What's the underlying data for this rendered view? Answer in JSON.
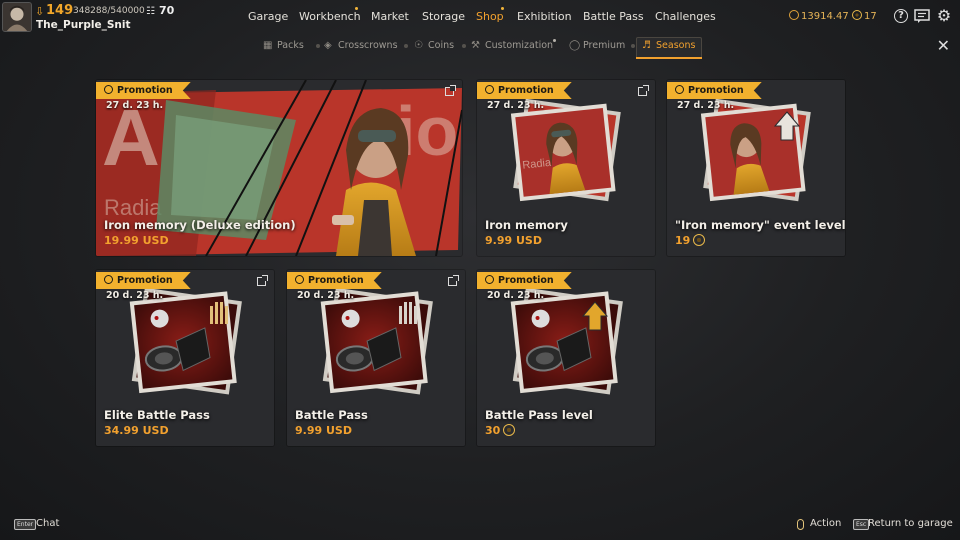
{
  "player": {
    "level": "149",
    "xp": "348288/540000",
    "prestige": "70",
    "username": "The_Purple_Snit"
  },
  "nav": {
    "items": [
      {
        "label": "Garage",
        "active": false,
        "dot": false
      },
      {
        "label": "Workbench",
        "active": false,
        "dot": true
      },
      {
        "label": "Market",
        "active": false,
        "dot": false
      },
      {
        "label": "Storage",
        "active": false,
        "dot": false
      },
      {
        "label": "Shop",
        "active": true,
        "dot": true
      },
      {
        "label": "Exhibition",
        "active": false,
        "dot": false
      },
      {
        "label": "Battle Pass",
        "active": false,
        "dot": false
      },
      {
        "label": "Challenges",
        "active": false,
        "dot": false
      }
    ]
  },
  "currencies": {
    "coins": "13914.47",
    "badges": "17"
  },
  "top_icons": [
    "help-icon",
    "news-icon",
    "settings-icon"
  ],
  "subtabs": [
    {
      "label": "Packs",
      "icon": "packs-icon"
    },
    {
      "label": "Crosscrowns",
      "icon": "crosscrowns-icon"
    },
    {
      "label": "Coins",
      "icon": "coins-icon"
    },
    {
      "label": "Customization",
      "icon": "customization-icon",
      "dot": true
    },
    {
      "label": "Premium",
      "icon": "premium-icon"
    },
    {
      "label": "Seasons",
      "icon": "seasons-icon",
      "active": true
    }
  ],
  "cards": [
    {
      "promo": "Promotion",
      "timer": "27 d. 23 h.",
      "title": "Iron memory (Deluxe edition)",
      "price": "19.99 USD",
      "external": true
    },
    {
      "promo": "Promotion",
      "timer": "27 d. 23 h.",
      "title": "Iron memory",
      "price": "9.99 USD",
      "external": true
    },
    {
      "promo": "Promotion",
      "timer": "27 d. 23 h.",
      "title": "\"Iron memory\" event level",
      "price": "19",
      "price_currency": "badge",
      "external": false
    },
    {
      "promo": "Promotion",
      "timer": "20 d. 23 h.",
      "title": "Elite Battle Pass",
      "price": "34.99 USD",
      "external": true
    },
    {
      "promo": "Promotion",
      "timer": "20 d. 23 h.",
      "title": "Battle Pass",
      "price": "9.99 USD",
      "external": true
    },
    {
      "promo": "Promotion",
      "timer": "20 d. 23 h.",
      "title": "Battle Pass level",
      "price": "30",
      "price_currency": "badge",
      "external": false
    }
  ],
  "footer": {
    "chat_key": "Enter",
    "chat_label": "Chat",
    "action_label": "Action",
    "return_key": "Esc",
    "return_label": "Return to garage"
  },
  "colors": {
    "accent": "#f2a12e",
    "promo_banner": "#f2b12e",
    "card_bg": "#2a2b2e"
  }
}
